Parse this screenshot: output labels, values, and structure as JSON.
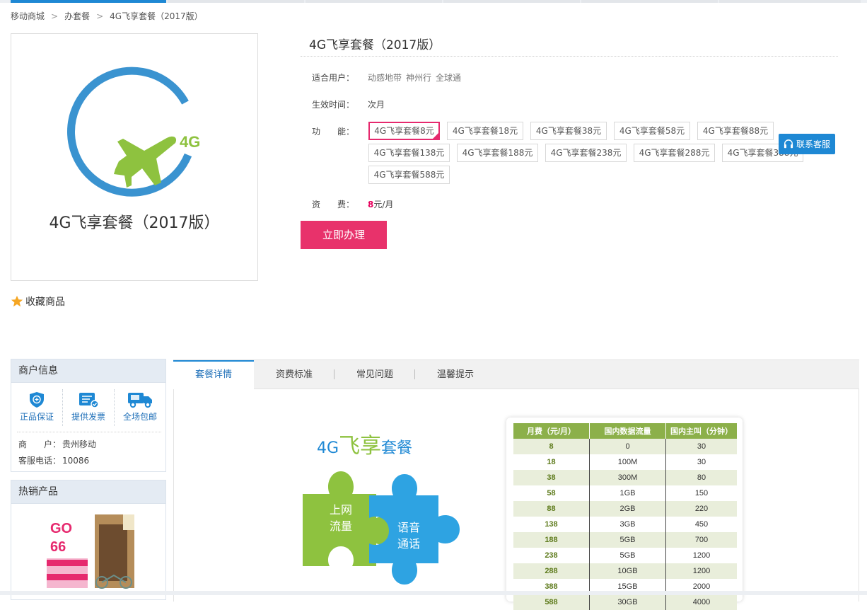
{
  "breadcrumb": [
    "移动商城",
    "办套餐",
    "4G飞享套餐（2017版）"
  ],
  "product": {
    "image_title": "4G飞享套餐（2017版）",
    "image_badge": "4G",
    "title": "4G飞享套餐（2017版）",
    "favorite_label": "收藏商品",
    "users_label": "适合用户：",
    "users": [
      "动感地带",
      "神州行",
      "全球通"
    ],
    "effective_label": "生效时间：",
    "effective_value": "次月",
    "feature_label": "功　　能：",
    "options": [
      "4G飞享套餐8元",
      "4G飞享套餐18元",
      "4G飞享套餐38元",
      "4G飞享套餐58元",
      "4G飞享套餐88元",
      "4G飞享套餐138元",
      "4G飞享套餐188元",
      "4G飞享套餐238元",
      "4G飞享套餐288元",
      "4G飞享套餐388元",
      "4G飞享套餐588元"
    ],
    "selected_option": "4G飞享套餐8元",
    "price_label": "资　　费：",
    "price_value": "8",
    "price_unit": "元/月",
    "buy_label": "立即办理"
  },
  "customer_service": {
    "label": "联系客服"
  },
  "merchant": {
    "title": "商户信息",
    "services": [
      {
        "label": "正品保证",
        "icon": "shield-icon"
      },
      {
        "label": "提供发票",
        "icon": "invoice-icon"
      },
      {
        "label": "全场包邮",
        "icon": "truck-icon"
      }
    ],
    "merchant_label": "商　　户：",
    "merchant_value": "贵州移动",
    "phone_label": "客服电话：",
    "phone_value": "10086"
  },
  "hot": {
    "title": "热销产品"
  },
  "tabs": [
    "套餐详情",
    "资费标准",
    "常见问题",
    "温馨提示"
  ],
  "banner": {
    "prefix": "4G",
    "highlight": "飞享",
    "suffix": "套餐",
    "piece1": [
      "上网",
      "流量"
    ],
    "piece2": [
      "语音",
      "通话"
    ]
  },
  "price_table": {
    "headers": [
      "月费（元/月）",
      "国内数据流量",
      "国内主叫（分钟）"
    ],
    "rows": [
      [
        "8",
        "0",
        "30"
      ],
      [
        "18",
        "100M",
        "30"
      ],
      [
        "38",
        "300M",
        "80"
      ],
      [
        "58",
        "1GB",
        "150"
      ],
      [
        "88",
        "2GB",
        "220"
      ],
      [
        "138",
        "3GB",
        "450"
      ],
      [
        "188",
        "5GB",
        "700"
      ],
      [
        "238",
        "5GB",
        "1200"
      ],
      [
        "288",
        "10GB",
        "1200"
      ],
      [
        "388",
        "15GB",
        "2000"
      ],
      [
        "588",
        "30GB",
        "4000"
      ]
    ]
  },
  "colors": {
    "accent": "#1e88d4",
    "buy": "#e8326b",
    "green": "#8cb04a"
  }
}
